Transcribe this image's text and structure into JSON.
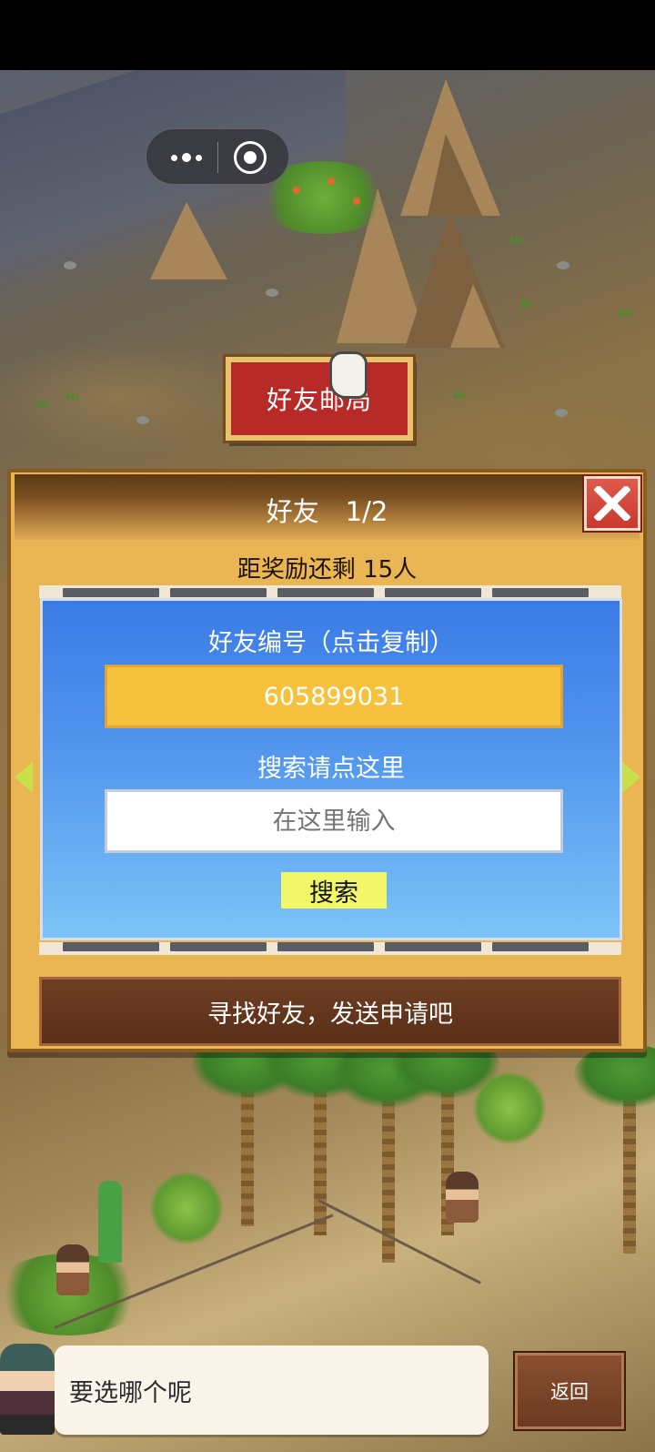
{
  "capsule": {
    "more_icon": "more-dots-icon",
    "close_icon": "target-circle-icon"
  },
  "building_sign": {
    "label": "好友邮局"
  },
  "panel": {
    "title": "好友　1/2",
    "close_icon": "close-x-icon",
    "reward_text": "距奖励还剩 15人",
    "id_label": "好友编号（点击复制）",
    "friend_id": "605899031",
    "search_label": "搜索请点这里",
    "search_placeholder": "在这里输入",
    "search_button": "搜索",
    "find_button": "寻找好友，发送申请吧",
    "prev_icon": "left-arrow-icon",
    "next_icon": "right-arrow-icon"
  },
  "dialog": {
    "text": "要选哪个呢"
  },
  "back_button": {
    "label": "返回"
  },
  "colors": {
    "panel_bg": "#eab553",
    "blue_top": "#3a7be6",
    "blue_bottom": "#7cc3f7",
    "id_box": "#f6c13d",
    "search_button": "#f2f76a",
    "close_red": "#d54b40",
    "find_button": "#6e3e23"
  }
}
